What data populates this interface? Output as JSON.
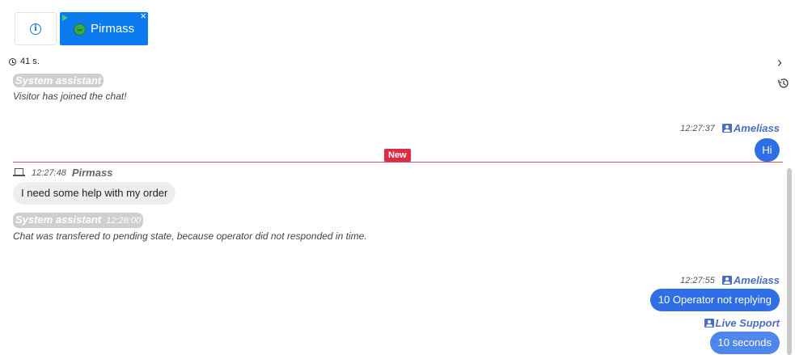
{
  "tabs": {
    "info_icon": "info-icon",
    "chat_tab_label": "Pirmass",
    "close_glyph": "×"
  },
  "timer": {
    "value": "41 s."
  },
  "nav": {
    "chevron": "›"
  },
  "messages": {
    "sys1": {
      "author": "System assistant",
      "text": "Visitor has joined the chat!"
    },
    "op1": {
      "time": "12:27:37",
      "author": "Ameliass",
      "text": "Hi"
    },
    "new_label": "New",
    "vis1": {
      "time": "12:27:48",
      "author": "Pirmass",
      "text": "I need some help with my order"
    },
    "sys2": {
      "author": "System assistant",
      "time": "12:28:00",
      "text": "Chat was transfered to pending state, because operator did not responded in time."
    },
    "op2": {
      "time": "12:27:55",
      "author": "Ameliass",
      "text": "10 Operator not replying"
    },
    "bot": {
      "author": "Live Support",
      "text": "10 seconds"
    }
  },
  "colors": {
    "accent": "#0d7bf0",
    "operator_bubble": "#2f6ee6",
    "operator_name": "#4a6ec6",
    "new_badge": "#dd2a45"
  }
}
